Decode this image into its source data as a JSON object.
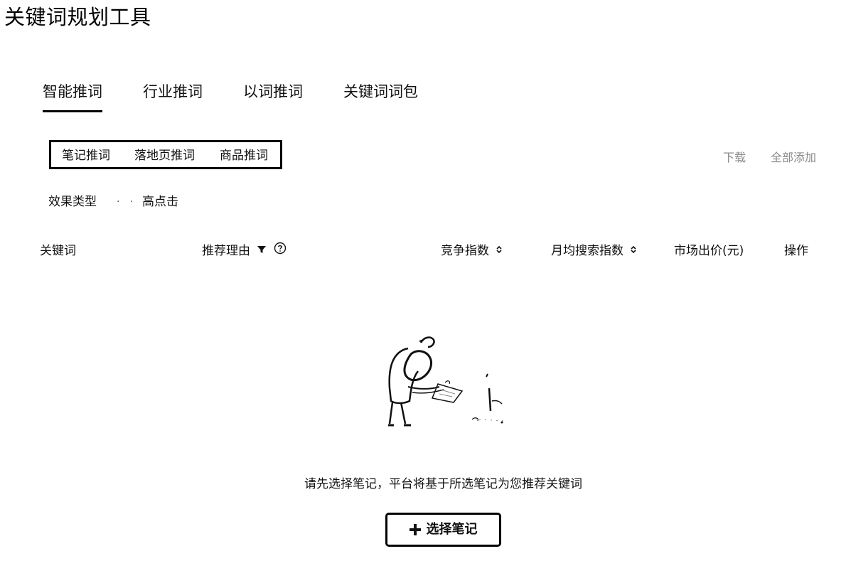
{
  "page": {
    "title": "关键词规划工具"
  },
  "main_tabs": [
    {
      "label": "智能推词",
      "active": true
    },
    {
      "label": "行业推词",
      "active": false
    },
    {
      "label": "以词推词",
      "active": false
    },
    {
      "label": "关键词词包",
      "active": false
    }
  ],
  "sub_tabs": [
    {
      "label": "笔记推词"
    },
    {
      "label": "落地页推词"
    },
    {
      "label": "商品推词"
    }
  ],
  "actions": {
    "download": "下载",
    "add_all": "全部添加"
  },
  "effect_filter": {
    "label": "效果类型",
    "value": "高点击"
  },
  "table": {
    "columns": [
      {
        "label": "关键词"
      },
      {
        "label": "推荐理由",
        "icons": [
          "filter-icon",
          "help-icon"
        ]
      },
      {
        "label": "竞争指数",
        "icons": [
          "sort-icon"
        ]
      },
      {
        "label": "月均搜索指数",
        "icons": [
          "sort-icon"
        ]
      },
      {
        "label": "市场出价(元)"
      },
      {
        "label": "操作"
      }
    ]
  },
  "empty_state": {
    "illustration": "person-reading-note-illustration",
    "message": "请先选择笔记，平台将基于所选笔记为您推荐关键词",
    "button_label": "选择笔记",
    "button_icon": "plus-icon"
  }
}
